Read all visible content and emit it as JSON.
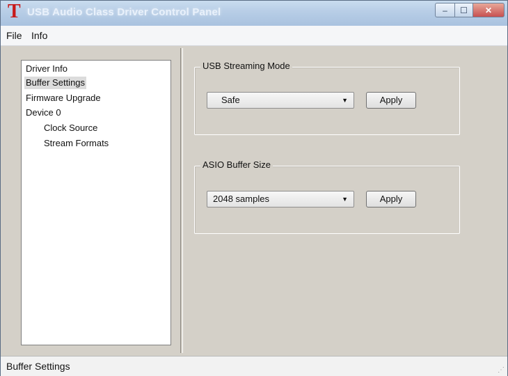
{
  "window": {
    "title": "USB Audio Class Driver Control Panel",
    "icon_glyph": "T",
    "icon_color": "#c81919",
    "controls": {
      "minimize": "–",
      "maximize": "☐",
      "close": "✕"
    }
  },
  "menu": {
    "items": [
      "File",
      "Info"
    ]
  },
  "tree": {
    "items": [
      {
        "label": "Driver Info",
        "level": 0,
        "selected": false
      },
      {
        "label": "Buffer Settings",
        "level": 0,
        "selected": true
      },
      {
        "label": "Firmware Upgrade",
        "level": 0,
        "selected": false
      },
      {
        "label": "Device 0",
        "level": 0,
        "selected": false
      },
      {
        "label": "Clock Source",
        "level": 1,
        "selected": false
      },
      {
        "label": "Stream Formats",
        "level": 1,
        "selected": false
      }
    ]
  },
  "usb_streaming": {
    "title": "USB Streaming Mode",
    "selected_value": "Safe",
    "apply_label": "Apply",
    "dropdown_icon": "chevron-down-icon"
  },
  "asio_buffer": {
    "title": "ASIO Buffer Size",
    "selected_value": "2048 samples",
    "apply_label": "Apply",
    "dropdown_icon": "chevron-down-icon"
  },
  "status_bar": {
    "text": "Buffer Settings"
  }
}
